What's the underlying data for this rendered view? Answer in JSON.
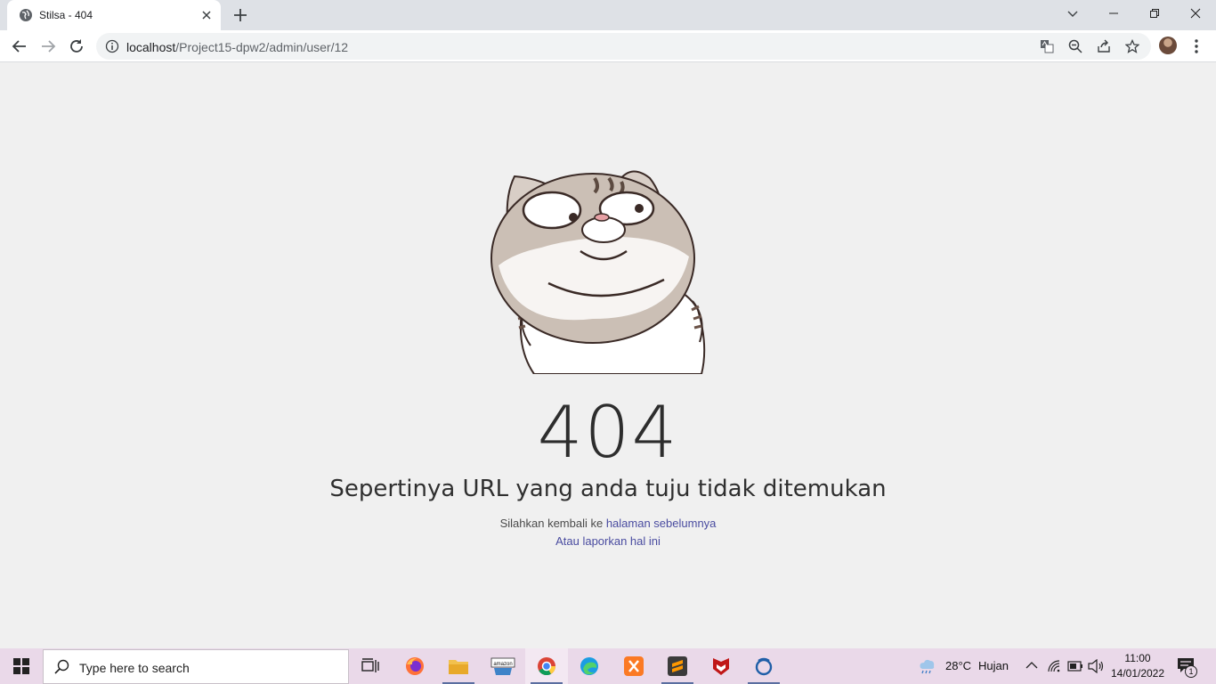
{
  "browser": {
    "tab_title": "Stilsa - 404",
    "url_host": "localhost",
    "url_path": "/Project15-dpw2/admin/user/12"
  },
  "page": {
    "error_code": "404",
    "headline": "Sepertinya URL yang anda tuju tidak ditemukan",
    "line1_prefix": "Silahkan kembali ke ",
    "line1_link": "halaman sebelumnya",
    "line2_prefix": "Atau ",
    "line2_link": "laporkan hal ini"
  },
  "taskbar": {
    "search_placeholder": "Type here to search",
    "weather_temp": "28°C",
    "weather_label": "Hujan",
    "time": "11:00",
    "date": "14/01/2022",
    "notification_count": "1",
    "apps": [
      "task-view",
      "firefox",
      "file-explorer",
      "amazon",
      "chrome",
      "edge",
      "xampp",
      "sublime-text",
      "mcafee",
      "other-app"
    ]
  }
}
